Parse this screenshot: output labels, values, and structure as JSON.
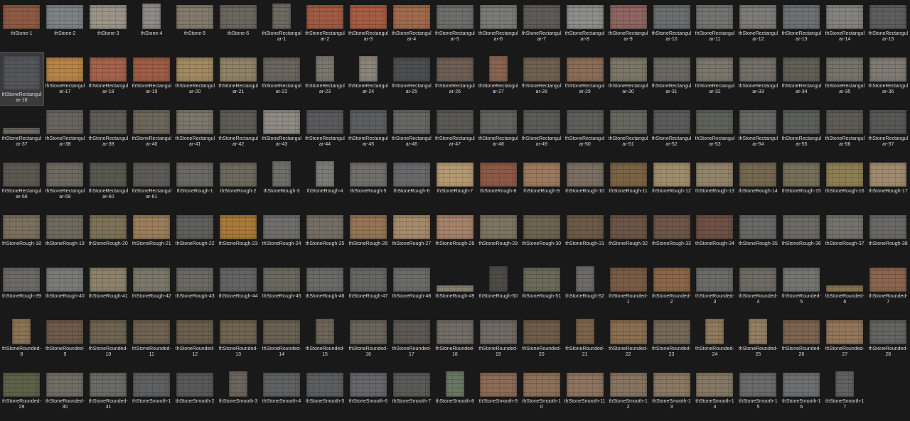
{
  "view": {
    "background": "#191919",
    "selected": "thStoneRectangular-16"
  },
  "files": [
    {
      "name": "thStone-1",
      "c": "#8f5a44",
      "shape": "land"
    },
    {
      "name": "thStone-2",
      "c": "#7c8285",
      "shape": "land"
    },
    {
      "name": "thStone-3",
      "c": "#9b9589",
      "shape": "land"
    },
    {
      "name": "thStone-4",
      "c": "#8d8c88",
      "shape": "port"
    },
    {
      "name": "thStone-5",
      "c": "#837a6d",
      "shape": "land"
    },
    {
      "name": "thStone-6",
      "c": "#6b6760",
      "shape": "land"
    },
    {
      "name": "thStoneRectangular-1",
      "c": "#6e6a64",
      "shape": "port"
    },
    {
      "name": "thStoneRectangular-2",
      "c": "#a05b44",
      "shape": "land"
    },
    {
      "name": "thStoneRectangular-3",
      "c": "#a55d44",
      "shape": "land"
    },
    {
      "name": "thStoneRectangular-4",
      "c": "#a06a4e",
      "shape": "land"
    },
    {
      "name": "thStoneRectangular-5",
      "c": "#6d6d6a",
      "shape": "land"
    },
    {
      "name": "thStoneRectangular-6",
      "c": "#7a7a76",
      "shape": "land"
    },
    {
      "name": "thStoneRectangular-7",
      "c": "#5e5c58",
      "shape": "land"
    },
    {
      "name": "thStoneRectangular-8",
      "c": "#8e8d8a",
      "shape": "land"
    },
    {
      "name": "thStoneRectangular-9",
      "c": "#8e6561",
      "shape": "land"
    },
    {
      "name": "thStoneRectangular-10",
      "c": "#6b6d6e",
      "shape": "land"
    },
    {
      "name": "thStoneRectangular-11",
      "c": "#737370",
      "shape": "land"
    },
    {
      "name": "thStoneRectangular-12",
      "c": "#7d7b77",
      "shape": "land"
    },
    {
      "name": "thStoneRectangular-13",
      "c": "#6e7073",
      "shape": "land"
    },
    {
      "name": "thStoneRectangular-14",
      "c": "#84837f",
      "shape": "land"
    },
    {
      "name": "thStoneRectangular-15",
      "c": "#5d5e5d",
      "shape": "land"
    },
    {
      "name": "thStoneRectangular-16",
      "c": "#55565a",
      "shape": "big"
    },
    {
      "name": "thStoneRectangular-17",
      "c": "#b7844a",
      "shape": "land"
    },
    {
      "name": "thStoneRectangular-18",
      "c": "#a5634c",
      "shape": "land"
    },
    {
      "name": "thStoneRectangular-19",
      "c": "#9d5d47",
      "shape": "land"
    },
    {
      "name": "thStoneRectangular-20",
      "c": "#a18a63",
      "shape": "land"
    },
    {
      "name": "thStoneRectangular-21",
      "c": "#8f8268",
      "shape": "land"
    },
    {
      "name": "thStoneRectangular-22",
      "c": "#6a655d",
      "shape": "land"
    },
    {
      "name": "thStoneRectangular-23",
      "c": "#7b786f",
      "shape": "port"
    },
    {
      "name": "thStoneRectangular-24",
      "c": "#8b857a",
      "shape": "port"
    },
    {
      "name": "thStoneRectangular-25",
      "c": "#4d4e50",
      "shape": "land"
    },
    {
      "name": "thStoneRectangular-26",
      "c": "#6d5f55",
      "shape": "land"
    },
    {
      "name": "thStoneRectangular-27",
      "c": "#8a6552",
      "shape": "port"
    },
    {
      "name": "thStoneRectangular-28",
      "c": "#6f614f",
      "shape": "land"
    },
    {
      "name": "thStoneRectangular-29",
      "c": "#8a6d58",
      "shape": "land"
    },
    {
      "name": "thStoneRectangular-30",
      "c": "#7b7667",
      "shape": "land"
    },
    {
      "name": "thStoneRectangular-31",
      "c": "#6b695f",
      "shape": "land"
    },
    {
      "name": "thStoneRectangular-32",
      "c": "#7b766b",
      "shape": "land"
    },
    {
      "name": "thStoneRectangular-33",
      "c": "#736f68",
      "shape": "land"
    },
    {
      "name": "thStoneRectangular-34",
      "c": "#625f55",
      "shape": "land"
    },
    {
      "name": "thStoneRectangular-35",
      "c": "#76736a",
      "shape": "land"
    },
    {
      "name": "thStoneRectangular-36",
      "c": "#7f7b73",
      "shape": "land"
    },
    {
      "name": "thStoneRectangular-37",
      "c": "#6f6c66",
      "shape": "flat"
    },
    {
      "name": "thStoneRectangular-38",
      "c": "#686560",
      "shape": "land"
    },
    {
      "name": "thStoneRectangular-39",
      "c": "#5f5d58",
      "shape": "land"
    },
    {
      "name": "thStoneRectangular-40",
      "c": "#6c665b",
      "shape": "land"
    },
    {
      "name": "thStoneRectangular-41",
      "c": "#7c766b",
      "shape": "land"
    },
    {
      "name": "thStoneRectangular-42",
      "c": "#5d5c55",
      "shape": "land"
    },
    {
      "name": "thStoneRectangular-43",
      "c": "#8e8a84",
      "shape": "land"
    },
    {
      "name": "thStoneRectangular-44",
      "c": "#5a5a5c",
      "shape": "land"
    },
    {
      "name": "thStoneRectangular-45",
      "c": "#5d5e5f",
      "shape": "land"
    },
    {
      "name": "thStoneRectangular-46",
      "c": "#666664",
      "shape": "land"
    },
    {
      "name": "thStoneRectangular-47",
      "c": "#5a5955",
      "shape": "land"
    },
    {
      "name": "thStoneRectangular-48",
      "c": "#626360",
      "shape": "land"
    },
    {
      "name": "thStoneRectangular-49",
      "c": "#5b5b59",
      "shape": "land"
    },
    {
      "name": "thStoneRectangular-50",
      "c": "#5e5f5b",
      "shape": "land"
    },
    {
      "name": "thStoneRectangular-51",
      "c": "#66675f",
      "shape": "land"
    },
    {
      "name": "thStoneRectangular-52",
      "c": "#5a5b5a",
      "shape": "land"
    },
    {
      "name": "thStoneRectangular-53",
      "c": "#5f6257",
      "shape": "land"
    },
    {
      "name": "thStoneRectangular-54",
      "c": "#676865",
      "shape": "land"
    },
    {
      "name": "thStoneRectangular-55",
      "c": "#5d5f5c",
      "shape": "land"
    },
    {
      "name": "thStoneRectangular-56",
      "c": "#5e5b57",
      "shape": "land"
    },
    {
      "name": "thStoneRectangular-57",
      "c": "#585957",
      "shape": "land"
    },
    {
      "name": "thStoneRectangular-58",
      "c": "#5c5852",
      "shape": "land"
    },
    {
      "name": "thStoneRectangular-59",
      "c": "#6e6961",
      "shape": "land"
    },
    {
      "name": "thStoneRectangular-60",
      "c": "#585a50",
      "shape": "land"
    },
    {
      "name": "thStoneRectangular-61",
      "c": "#5e5c59",
      "shape": "land"
    },
    {
      "name": "thStoneRough-1",
      "c": "#6a6965",
      "shape": "land"
    },
    {
      "name": "thStoneRough-2",
      "c": "#6e695e",
      "shape": "land"
    },
    {
      "name": "thStoneRough-3",
      "c": "#6f706a",
      "shape": "port"
    },
    {
      "name": "thStoneRough-4",
      "c": "#7c7d78",
      "shape": "port"
    },
    {
      "name": "thStoneRough-5",
      "c": "#71706b",
      "shape": "land"
    },
    {
      "name": "thStoneRough-6",
      "c": "#68696a",
      "shape": "land"
    },
    {
      "name": "thStoneRough-7",
      "c": "#b49a72",
      "shape": "land"
    },
    {
      "name": "thStoneRough-8",
      "c": "#8d5a48",
      "shape": "land"
    },
    {
      "name": "thStoneRough-9",
      "c": "#9b7a60",
      "shape": "land"
    },
    {
      "name": "thStoneRough-10",
      "c": "#7b6f63",
      "shape": "land"
    },
    {
      "name": "thStoneRough-11",
      "c": "#7a6444",
      "shape": "land"
    },
    {
      "name": "thStoneRough-12",
      "c": "#a08d6d",
      "shape": "land"
    },
    {
      "name": "thStoneRough-13",
      "c": "#93856a",
      "shape": "land"
    },
    {
      "name": "thStoneRough-14",
      "c": "#756850",
      "shape": "land"
    },
    {
      "name": "thStoneRough-15",
      "c": "#747059",
      "shape": "land"
    },
    {
      "name": "thStoneRough-16",
      "c": "#8e7f54",
      "shape": "land"
    },
    {
      "name": "thStoneRough-17",
      "c": "#a08b70",
      "shape": "land"
    },
    {
      "name": "thStoneRough-18",
      "c": "#7a715e",
      "shape": "land"
    },
    {
      "name": "thStoneRough-19",
      "c": "#6e6a5e",
      "shape": "land"
    },
    {
      "name": "thStoneRough-20",
      "c": "#7d7258",
      "shape": "land"
    },
    {
      "name": "thStoneRough-21",
      "c": "#9a7e5c",
      "shape": "land"
    },
    {
      "name": "thStoneRough-22",
      "c": "#5f5f5d",
      "shape": "land"
    },
    {
      "name": "thStoneRough-23",
      "c": "#a87a39",
      "shape": "land"
    },
    {
      "name": "thStoneRough-24",
      "c": "#6f6e6d",
      "shape": "land"
    },
    {
      "name": "thStoneRough-25",
      "c": "#746e64",
      "shape": "land"
    },
    {
      "name": "thStoneRough-26",
      "c": "#957555",
      "shape": "land"
    },
    {
      "name": "thStoneRough-27",
      "c": "#a58a6c",
      "shape": "land"
    },
    {
      "name": "thStoneRough-28",
      "c": "#a5826a",
      "shape": "land"
    },
    {
      "name": "thStoneRough-29",
      "c": "#7c7563",
      "shape": "land"
    },
    {
      "name": "thStoneRough-30",
      "c": "#6c6450",
      "shape": "land"
    },
    {
      "name": "thStoneRough-31",
      "c": "#6b5a48",
      "shape": "land"
    },
    {
      "name": "thStoneRough-32",
      "c": "#6b5546",
      "shape": "land"
    },
    {
      "name": "thStoneRough-33",
      "c": "#6e5648",
      "shape": "land"
    },
    {
      "name": "thStoneRough-34",
      "c": "#6e5046",
      "shape": "land"
    },
    {
      "name": "thStoneRough-35",
      "c": "#686865",
      "shape": "land"
    },
    {
      "name": "thStoneRough-36",
      "c": "#6b6a66",
      "shape": "land"
    },
    {
      "name": "thStoneRough-37",
      "c": "#73726d",
      "shape": "land"
    },
    {
      "name": "thStoneRough-38",
      "c": "#6a6966",
      "shape": "land"
    },
    {
      "name": "thStoneRough-39",
      "c": "#6c6a66",
      "shape": "land"
    },
    {
      "name": "thStoneRough-40",
      "c": "#7a7a78",
      "shape": "land"
    },
    {
      "name": "thStoneRough-41",
      "c": "#8d836d",
      "shape": "land"
    },
    {
      "name": "thStoneRough-42",
      "c": "#7c776b",
      "shape": "land"
    },
    {
      "name": "thStoneRough-43",
      "c": "#6a6962",
      "shape": "land"
    },
    {
      "name": "thStoneRough-44",
      "c": "#646464",
      "shape": "land"
    },
    {
      "name": "thStoneRough-45",
      "c": "#69695f",
      "shape": "land"
    },
    {
      "name": "thStoneRough-46",
      "c": "#6a6a68",
      "shape": "land"
    },
    {
      "name": "thStoneRough-47",
      "c": "#666665",
      "shape": "land"
    },
    {
      "name": "thStoneRough-48",
      "c": "#6b6b69",
      "shape": "land"
    },
    {
      "name": "thStoneRough-49",
      "c": "#8d8678",
      "shape": "flat"
    },
    {
      "name": "thStoneRough-50",
      "c": "#4f4c48",
      "shape": "port"
    },
    {
      "name": "thStoneRough-51",
      "c": "#6a6b58",
      "shape": "land"
    },
    {
      "name": "thStoneRough-52",
      "c": "#6d6c68",
      "shape": "port"
    },
    {
      "name": "thStoneRounded-1",
      "c": "#7a5c45",
      "shape": "land"
    },
    {
      "name": "thStoneRounded-2",
      "c": "#8a6748",
      "shape": "land"
    },
    {
      "name": "thStoneRounded-3",
      "c": "#6b6b69",
      "shape": "land"
    },
    {
      "name": "thStoneRounded-4",
      "c": "#6d6c64",
      "shape": "land"
    },
    {
      "name": "thStoneRounded-5",
      "c": "#757570",
      "shape": "land"
    },
    {
      "name": "thStoneRounded-6",
      "c": "#8f7755",
      "shape": "flat"
    },
    {
      "name": "thStoneRounded-7",
      "c": "#8a6650",
      "shape": "land"
    },
    {
      "name": "thStoneRounded-8",
      "c": "#8b7455",
      "shape": "port"
    },
    {
      "name": "thStoneRounded-9",
      "c": "#6e5a4a",
      "shape": "land"
    },
    {
      "name": "thStoneRounded-10",
      "c": "#6e6452",
      "shape": "land"
    },
    {
      "name": "thStoneRounded-11",
      "c": "#6e6251",
      "shape": "land"
    },
    {
      "name": "thStoneRounded-12",
      "c": "#6a5f4e",
      "shape": "land"
    },
    {
      "name": "thStoneRounded-13",
      "c": "#6f6450",
      "shape": "land"
    },
    {
      "name": "thStoneRounded-14",
      "c": "#696253",
      "shape": "land"
    },
    {
      "name": "thStoneRounded-15",
      "c": "#6d6657",
      "shape": "port"
    },
    {
      "name": "thStoneRounded-16",
      "c": "#6a655b",
      "shape": "land"
    },
    {
      "name": "thStoneRounded-17",
      "c": "#5c5955",
      "shape": "land"
    },
    {
      "name": "thStoneRounded-18",
      "c": "#716c66",
      "shape": "land"
    },
    {
      "name": "thStoneRounded-19",
      "c": "#706a62",
      "shape": "land"
    },
    {
      "name": "thStoneRounded-20",
      "c": "#6e5c49",
      "shape": "land"
    },
    {
      "name": "thStoneRounded-21",
      "c": "#7c644c",
      "shape": "port"
    },
    {
      "name": "thStoneRounded-22",
      "c": "#8a6e52",
      "shape": "land"
    },
    {
      "name": "thStoneRounded-23",
      "c": "#746857",
      "shape": "land"
    },
    {
      "name": "thStoneRounded-24",
      "c": "#8f7a5d",
      "shape": "port"
    },
    {
      "name": "thStoneRounded-25",
      "c": "#957f63",
      "shape": "port"
    },
    {
      "name": "thStoneRounded-26",
      "c": "#7d6450",
      "shape": "land"
    },
    {
      "name": "thStoneRounded-27",
      "c": "#93765a",
      "shape": "land"
    },
    {
      "name": "thStoneRounded-28",
      "c": "#646461",
      "shape": "land"
    },
    {
      "name": "thStoneRounded-29",
      "c": "#5e6249",
      "shape": "land"
    },
    {
      "name": "thStoneRounded-30",
      "c": "#6f6d66",
      "shape": "land"
    },
    {
      "name": "thStoneRounded-31",
      "c": "#6b6a66",
      "shape": "land"
    },
    {
      "name": "thStoneSmooth-1",
      "c": "#5f6061",
      "shape": "land"
    },
    {
      "name": "thStoneSmooth-2",
      "c": "#59595a",
      "shape": "land"
    },
    {
      "name": "thStoneSmooth-3",
      "c": "#6b675e",
      "shape": "port"
    },
    {
      "name": "thStoneSmooth-4",
      "c": "#5f6162",
      "shape": "land"
    },
    {
      "name": "thStoneSmooth-5",
      "c": "#5d5e60",
      "shape": "land"
    },
    {
      "name": "thStoneSmooth-6",
      "c": "#66676a",
      "shape": "land"
    },
    {
      "name": "thStoneSmooth-7",
      "c": "#5a5a59",
      "shape": "land"
    },
    {
      "name": "thStoneSmooth-8",
      "c": "#6a7864",
      "shape": "port"
    },
    {
      "name": "thStoneSmooth-9",
      "c": "#8c6b57",
      "shape": "land"
    },
    {
      "name": "thStoneSmooth-10",
      "c": "#8d7059",
      "shape": "land"
    },
    {
      "name": "thStoneSmooth-11",
      "c": "#8e7460",
      "shape": "land"
    },
    {
      "name": "thStoneSmooth-12",
      "c": "#867461",
      "shape": "land"
    },
    {
      "name": "thStoneSmooth-13",
      "c": "#8a7863",
      "shape": "land"
    },
    {
      "name": "thStoneSmooth-14",
      "c": "#857865",
      "shape": "land"
    },
    {
      "name": "thStoneSmooth-15",
      "c": "#6a6a69",
      "shape": "land"
    },
    {
      "name": "thStoneSmooth-16",
      "c": "#6e6f70",
      "shape": "land"
    },
    {
      "name": "thStoneSmooth-17",
      "c": "#626263",
      "shape": "port"
    }
  ]
}
